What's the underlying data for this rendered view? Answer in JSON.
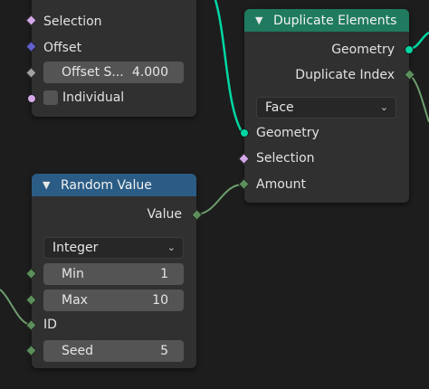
{
  "colors": {
    "background": "#1d1d1d",
    "node_body": "#303030",
    "duplicate_header": "#1f7a5f",
    "random_header": "#2a5c85",
    "geometry_socket": "#00d6a3",
    "field_wire": "#6e9e6e"
  },
  "top_node": {
    "selection_label": "Selection",
    "offset_label": "Offset",
    "offset_scale_label": "Offset S...",
    "offset_scale_value": "4.000",
    "individual_label": "Individual"
  },
  "duplicate_node": {
    "title": "Duplicate Elements",
    "out_geometry": "Geometry",
    "out_duplicate_index": "Duplicate Index",
    "domain_value": "Face",
    "in_geometry": "Geometry",
    "in_selection": "Selection",
    "in_amount": "Amount"
  },
  "random_node": {
    "title": "Random Value",
    "out_value": "Value",
    "type_value": "Integer",
    "min_label": "Min",
    "min_value": "1",
    "max_label": "Max",
    "max_value": "10",
    "id_label": "ID",
    "seed_label": "Seed",
    "seed_value": "5"
  },
  "icons": {
    "collapse": "chevron-down-icon",
    "dropdown": "chevron-down-icon",
    "geometry_socket": "circle-socket-icon",
    "field_socket": "diamond-socket-icon"
  }
}
